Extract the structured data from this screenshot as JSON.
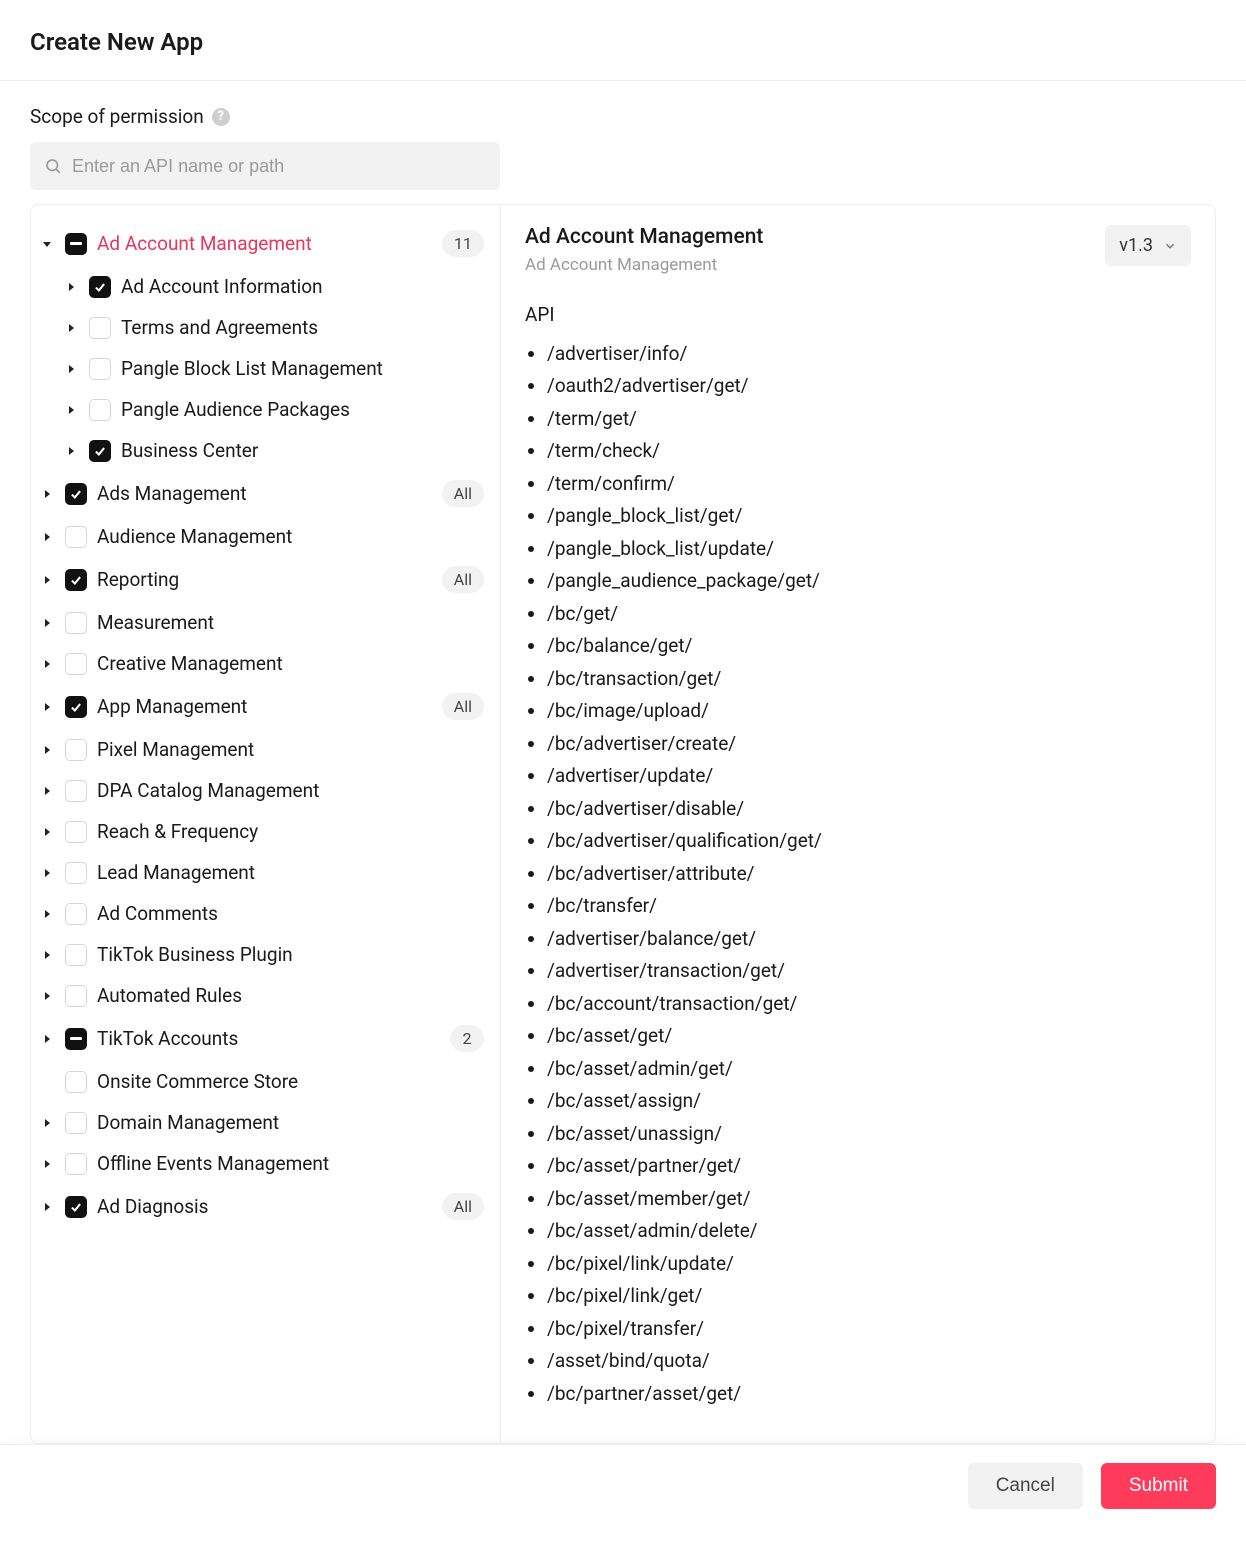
{
  "header": {
    "title": "Create New App"
  },
  "section": {
    "label": "Scope of permission"
  },
  "search": {
    "placeholder": "Enter an API name or path"
  },
  "tree": [
    {
      "label": "Ad Account Management",
      "state": "partial",
      "caret": "down",
      "active": true,
      "badge": "11",
      "children": [
        {
          "label": "Ad Account Information",
          "state": "checked",
          "caret": "right"
        },
        {
          "label": "Terms and Agreements",
          "state": "unchecked",
          "caret": "right"
        },
        {
          "label": "Pangle Block List Management",
          "state": "unchecked",
          "caret": "right"
        },
        {
          "label": "Pangle Audience Packages",
          "state": "unchecked",
          "caret": "right"
        },
        {
          "label": "Business Center",
          "state": "checked",
          "caret": "right"
        }
      ]
    },
    {
      "label": "Ads Management",
      "state": "checked",
      "caret": "right",
      "badge": "All"
    },
    {
      "label": "Audience Management",
      "state": "unchecked",
      "caret": "right"
    },
    {
      "label": "Reporting",
      "state": "checked",
      "caret": "right",
      "badge": "All"
    },
    {
      "label": "Measurement",
      "state": "unchecked",
      "caret": "right"
    },
    {
      "label": "Creative Management",
      "state": "unchecked",
      "caret": "right"
    },
    {
      "label": "App Management",
      "state": "checked",
      "caret": "right",
      "badge": "All"
    },
    {
      "label": "Pixel Management",
      "state": "unchecked",
      "caret": "right"
    },
    {
      "label": "DPA Catalog Management",
      "state": "unchecked",
      "caret": "right"
    },
    {
      "label": "Reach & Frequency",
      "state": "unchecked",
      "caret": "right"
    },
    {
      "label": "Lead Management",
      "state": "unchecked",
      "caret": "right"
    },
    {
      "label": "Ad Comments",
      "state": "unchecked",
      "caret": "right"
    },
    {
      "label": "TikTok Business Plugin",
      "state": "unchecked",
      "caret": "right"
    },
    {
      "label": "Automated Rules",
      "state": "unchecked",
      "caret": "right"
    },
    {
      "label": "TikTok Accounts",
      "state": "partial",
      "caret": "right",
      "badge": "2"
    },
    {
      "label": "Onsite Commerce Store",
      "state": "unchecked",
      "caret": "none"
    },
    {
      "label": "Domain Management",
      "state": "unchecked",
      "caret": "right"
    },
    {
      "label": "Offline Events Management",
      "state": "unchecked",
      "caret": "right"
    },
    {
      "label": "Ad Diagnosis",
      "state": "checked",
      "caret": "right",
      "badge": "All"
    }
  ],
  "detail": {
    "title": "Ad Account Management",
    "subtitle": "Ad Account Management",
    "version": "v1.3",
    "api_heading": "API",
    "apis": [
      "/advertiser/info/",
      "/oauth2/advertiser/get/",
      "/term/get/",
      "/term/check/",
      "/term/confirm/",
      "/pangle_block_list/get/",
      "/pangle_block_list/update/",
      "/pangle_audience_package/get/",
      "/bc/get/",
      "/bc/balance/get/",
      "/bc/transaction/get/",
      "/bc/image/upload/",
      "/bc/advertiser/create/",
      "/advertiser/update/",
      "/bc/advertiser/disable/",
      "/bc/advertiser/qualification/get/",
      "/bc/advertiser/attribute/",
      "/bc/transfer/",
      "/advertiser/balance/get/",
      "/advertiser/transaction/get/",
      "/bc/account/transaction/get/",
      "/bc/asset/get/",
      "/bc/asset/admin/get/",
      "/bc/asset/assign/",
      "/bc/asset/unassign/",
      "/bc/asset/partner/get/",
      "/bc/asset/member/get/",
      "/bc/asset/admin/delete/",
      "/bc/pixel/link/update/",
      "/bc/pixel/link/get/",
      "/bc/pixel/transfer/",
      "/asset/bind/quota/",
      "/bc/partner/asset/get/"
    ]
  },
  "footer": {
    "cancel": "Cancel",
    "submit": "Submit"
  }
}
